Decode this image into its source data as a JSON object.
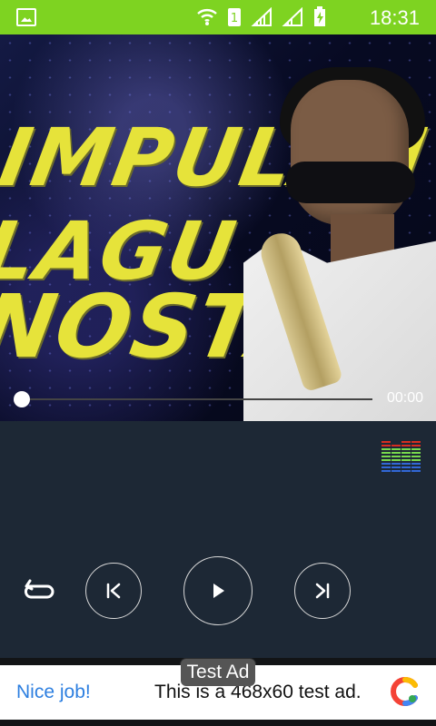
{
  "status_bar": {
    "time": "18:31"
  },
  "video": {
    "title_line_1": "IMPULAN LAGU",
    "title_line_2": "NOSTALGIA",
    "time_label": "00:00",
    "progress": 0
  },
  "controls": {
    "repeat": "repeat-icon",
    "previous": "previous-icon",
    "play": "play-icon",
    "next": "next-icon",
    "equalizer": "equalizer-icon"
  },
  "ad": {
    "badge": "Test Ad",
    "left_text": "Nice job!",
    "main_text": "This is a 468x60 test ad.",
    "logo": "ad-logo-icon"
  }
}
